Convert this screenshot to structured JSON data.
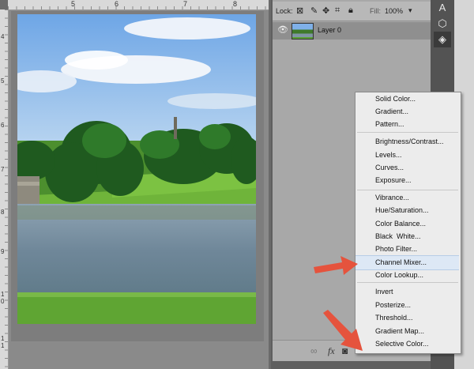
{
  "ruler": {
    "top_numbers": [
      "5",
      "6",
      "7",
      "8"
    ],
    "left_numbers": [
      "4",
      "5",
      "6",
      "7",
      "8",
      "9",
      "1\n0",
      "1\n1"
    ]
  },
  "layers_panel": {
    "lock_label": "Lock:",
    "fill_label": "Fill:",
    "fill_value": "100%",
    "layer_name": "Layer 0"
  },
  "menu": {
    "items": [
      "Solid Color...",
      "Gradient...",
      "Pattern...",
      "Brightness/Contrast...",
      "Levels...",
      "Curves...",
      "Exposure...",
      "Vibrance...",
      "Hue/Saturation...",
      "Color Balance...",
      "Black  White...",
      "Photo Filter...",
      "Channel Mixer...",
      "Color Lookup...",
      "Invert",
      "Posterize...",
      "Threshold...",
      "Gradient Map...",
      "Selective Color..."
    ],
    "highlighted": "Channel Mixer..."
  },
  "bottom_bar": {
    "fx_label": "fx"
  },
  "icons": {
    "lock_transparent": "lock-transparent-icon",
    "lock_brush": "brush-icon",
    "lock_move": "move-icon",
    "lock_artboard": "artboard-icon",
    "lock_all": "padlock-icon",
    "visibility": "eye-icon",
    "link": "link-icon",
    "mask": "mask-icon",
    "adjustment": "half-circle-icon"
  },
  "colors": {
    "arrow": "#e5533d",
    "menu_highlight": "#dde8f5"
  }
}
